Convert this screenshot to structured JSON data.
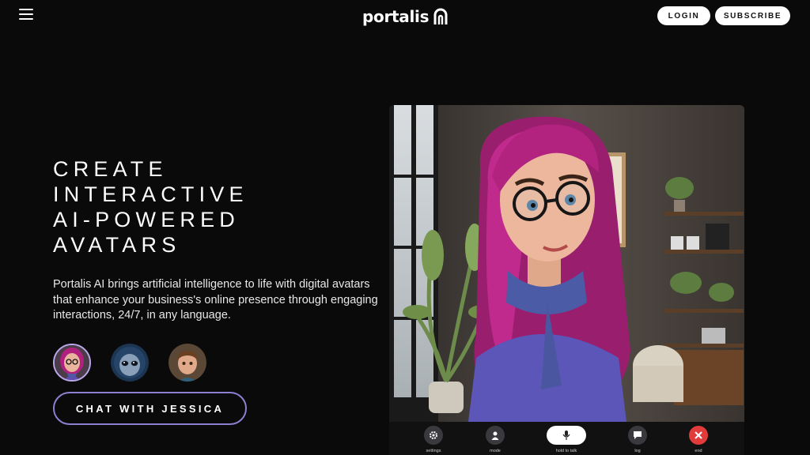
{
  "header": {
    "logo_text": "portalis",
    "login_label": "LOGIN",
    "subscribe_label": "SUBSCRIBE"
  },
  "hero": {
    "headline_lines": [
      "CREATE",
      "INTERACTIVE",
      "AI-POWERED",
      "AVATARS"
    ],
    "description": "Portalis AI brings artificial intelligence to life with digital avatars that enhance your business's online presence through engaging interactions, 24/7, in any language.",
    "cta_label": "CHAT WITH JESSICA"
  },
  "avatars": [
    {
      "icon": "jessica-avatar",
      "selected": true
    },
    {
      "icon": "alien-avatar",
      "selected": false
    },
    {
      "icon": "boy-avatar",
      "selected": false
    }
  ],
  "video_controls": {
    "settings": "settings",
    "mode": "mode",
    "talk": "hold to talk",
    "log": "log",
    "end": "end"
  },
  "colors": {
    "background": "#0a0a0a",
    "accent_border": "#8f7fd0",
    "end_call": "#e23b3b"
  }
}
